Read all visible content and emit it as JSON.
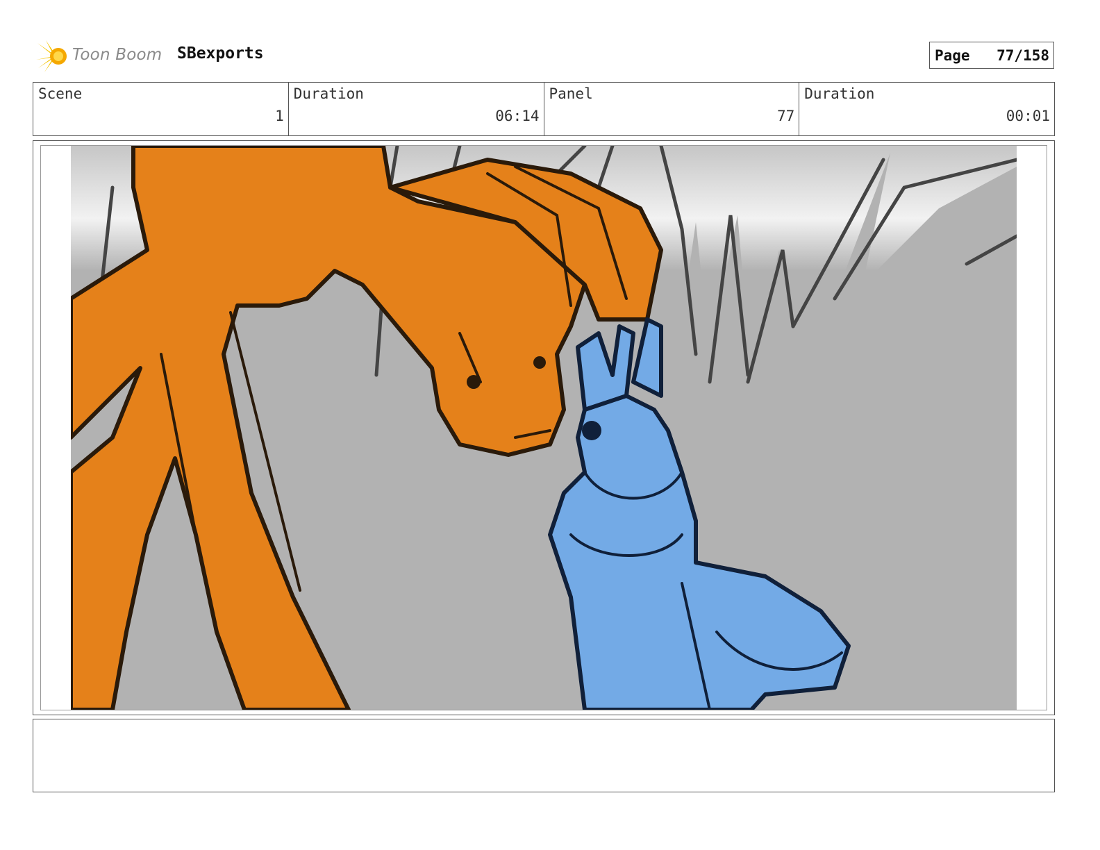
{
  "header": {
    "brand_name": "Toon Boom",
    "project_name": "SBexports",
    "page_label": "Page",
    "page_value": "77/158"
  },
  "info": [
    {
      "label": "Scene",
      "value": "1"
    },
    {
      "label": "Duration",
      "value": "06:14"
    },
    {
      "label": "Panel",
      "value": "77"
    },
    {
      "label": "Duration",
      "value": "00:01"
    }
  ],
  "panel": {
    "image": "storyboard-sketch",
    "colors": {
      "background_gray": "#b2b2b2",
      "sky_light": "#f2f2f2",
      "orange_character": "#e5811a",
      "blue_character": "#73aae6",
      "ink": "#1a1a1a"
    }
  },
  "notes": {
    "text": ""
  }
}
